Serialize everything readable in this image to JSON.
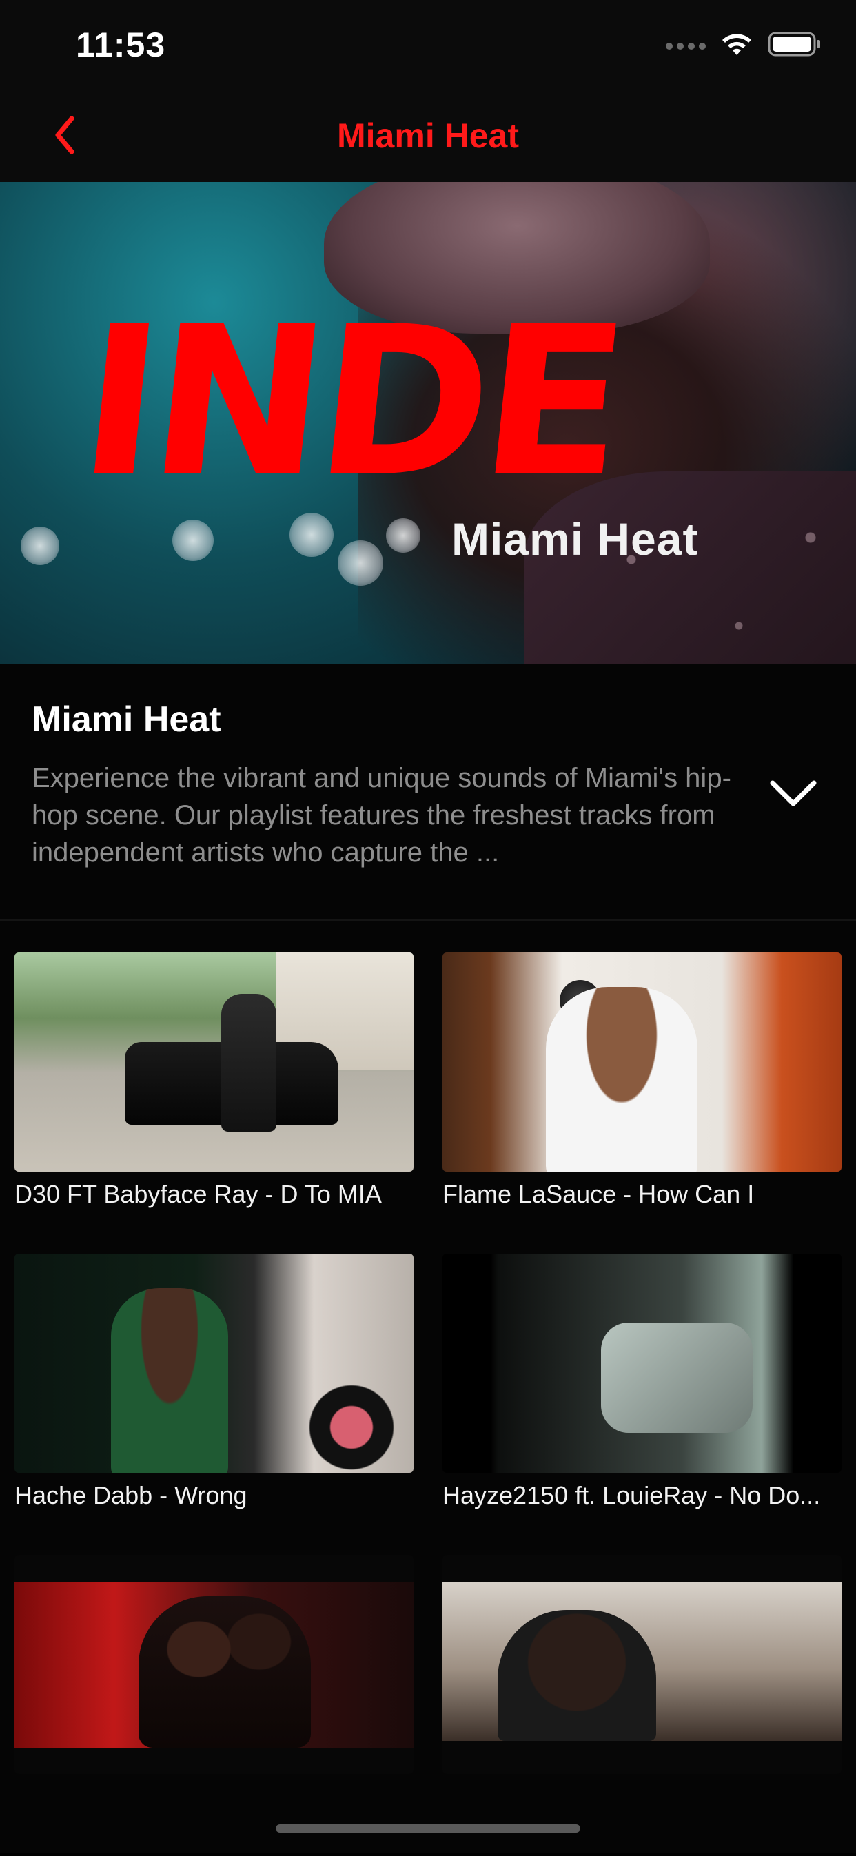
{
  "status_bar": {
    "time": "11:53",
    "icons": [
      "cellular-signal-icon",
      "wifi-icon",
      "battery-icon"
    ]
  },
  "nav": {
    "back_icon": "chevron-left-icon",
    "title": "Miami Heat",
    "accent_color": "#ff1a1a"
  },
  "hero": {
    "logo_text": "INDE",
    "subtitle": "Miami Heat",
    "logo_color": "#ff0000"
  },
  "playlist": {
    "title": "Miami Heat",
    "description": "Experience the vibrant and unique sounds of Miami's hip-hop scene. Our playlist features the freshest tracks from independent artists who capture the ...",
    "expand_icon": "chevron-down-icon"
  },
  "videos": [
    {
      "title": "D30 FT Babyface Ray - D To MIA"
    },
    {
      "title": "Flame LaSauce - How Can I"
    },
    {
      "title": "Hache Dabb - Wrong"
    },
    {
      "title": "Hayze2150 ft. LouieRay - No Do..."
    },
    {
      "title": ""
    },
    {
      "title": ""
    }
  ]
}
